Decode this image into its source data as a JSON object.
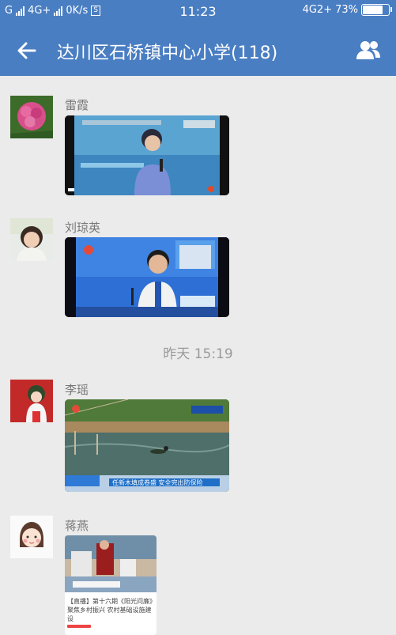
{
  "status_bar": {
    "carrier_left": "G",
    "network_mid": "4G+",
    "speed": "0K/s",
    "sd_icon": "S",
    "time": "11:23",
    "network_right": "4G2+",
    "battery_percent": "73%",
    "battery_level": 0.73
  },
  "nav": {
    "title": "达川区石桥镇中心小学(118)",
    "back_icon": "arrow-left-icon",
    "members_icon": "group-members-icon"
  },
  "messages": [
    {
      "sender": "雷霞",
      "type": "video",
      "caption": ""
    },
    {
      "sender": "刘琼英",
      "type": "video",
      "caption": ""
    },
    {
      "sender": "李瑶",
      "type": "video",
      "caption": "任新木填成卷盛 安全完出防保险"
    },
    {
      "sender": "蒋燕",
      "type": "article",
      "caption": "【直播】第十六期《阳光问廉》聚焦乡村振兴 农村基础设施建设"
    }
  ],
  "time_separator": "昨天   15:19",
  "colors": {
    "header": "#4a7ec2",
    "background": "#ebebeb"
  }
}
